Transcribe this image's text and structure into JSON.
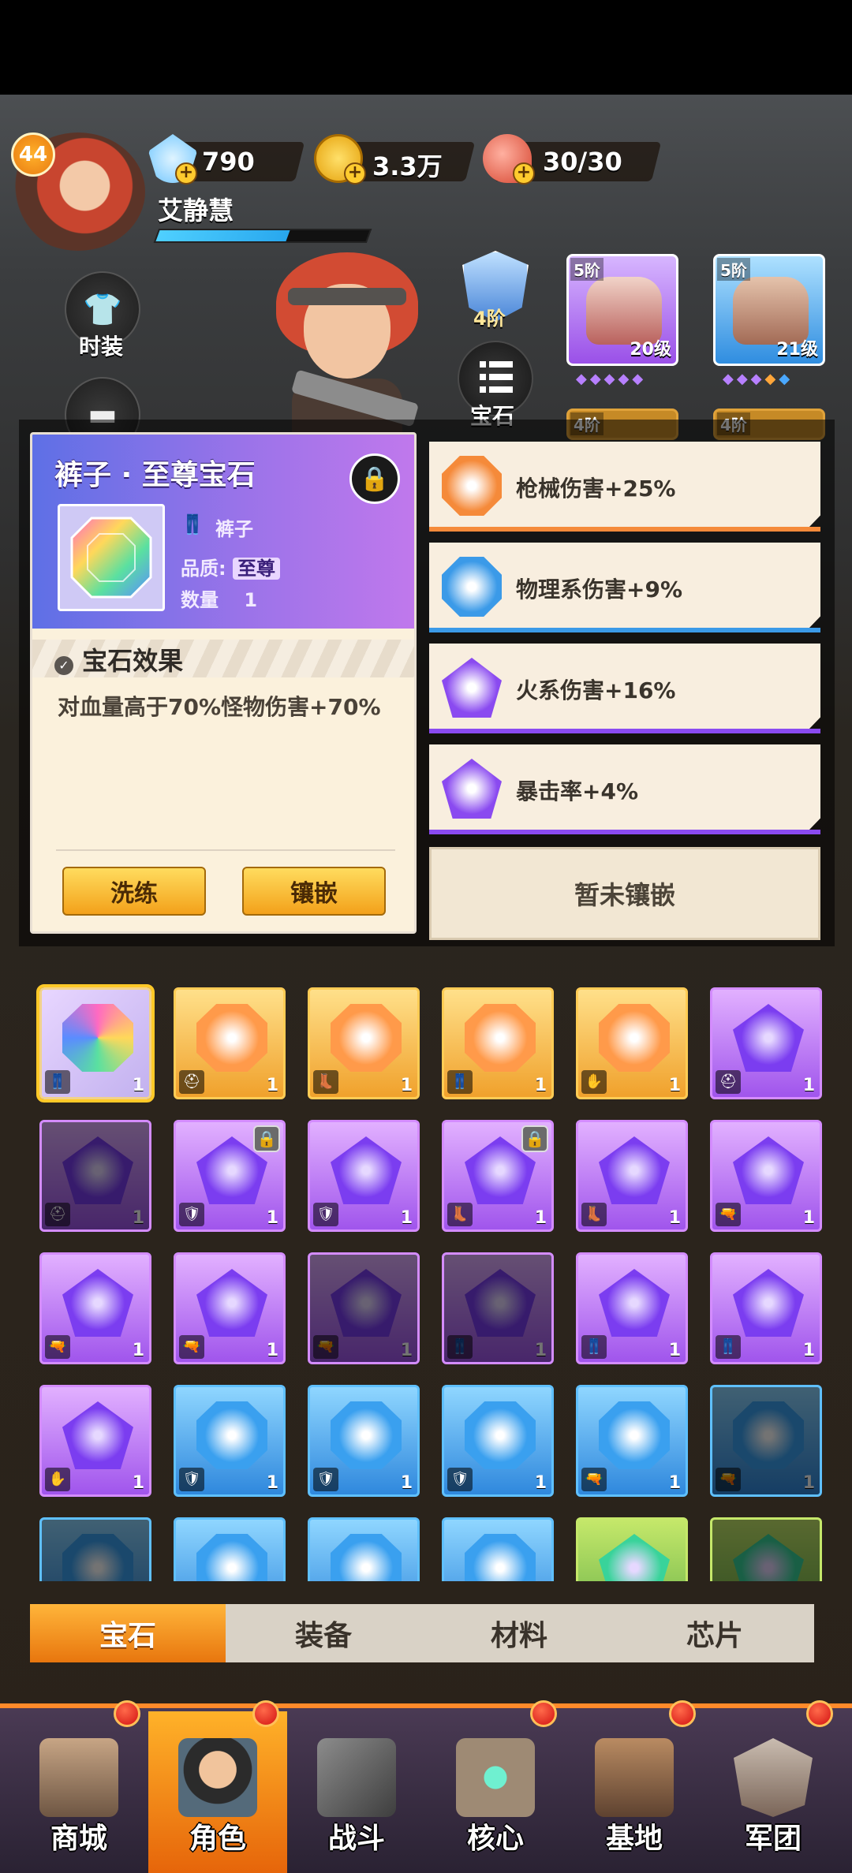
{
  "player": {
    "level": "44",
    "name": "艾静慧",
    "exp_fraction": 0.62
  },
  "resources": {
    "diamonds": "790",
    "coins": "3.3万",
    "stamina": "30/30"
  },
  "side_menu": {
    "fashion_label": "时装"
  },
  "rank": {
    "label": "4阶"
  },
  "gem_menu": {
    "label": "宝石"
  },
  "equipment": [
    {
      "tier": "5阶",
      "level": "20级"
    },
    {
      "tier": "5阶",
      "level": "21级"
    },
    {
      "tier": "4阶"
    },
    {
      "tier": "4阶"
    }
  ],
  "gem_detail": {
    "title": "裤子 · 至尊宝石",
    "slot_name": "裤子",
    "quality_label": "品质:",
    "quality_value": "至尊",
    "count_label": "数量",
    "count_value": "1",
    "effect_title": "宝石效果",
    "effect_text": "对血量高于70%怪物伤害+70%",
    "reroll_label": "洗练",
    "inlay_label": "镶嵌"
  },
  "attributes": [
    {
      "text": "枪械伤害+25%",
      "color": "#f58a3a"
    },
    {
      "text": "物理系伤害+9%",
      "color": "#3b9ae8"
    },
    {
      "text": "火系伤害+16%",
      "color": "#8a4af0"
    },
    {
      "text": "暴击率+4%",
      "color": "#8a4af0"
    }
  ],
  "not_inlaid_label": "暂未镶嵌",
  "inventory": [
    {
      "type": "rainbow",
      "part": "pants",
      "qty": "1",
      "selected": true
    },
    {
      "type": "orange",
      "part": "helmet",
      "qty": "1"
    },
    {
      "type": "orange",
      "part": "boots",
      "qty": "1"
    },
    {
      "type": "orange",
      "part": "pants",
      "qty": "1"
    },
    {
      "type": "orange",
      "part": "glove",
      "qty": "1"
    },
    {
      "type": "purple",
      "part": "helmet",
      "qty": "1"
    },
    {
      "type": "purple",
      "part": "helmet",
      "qty": "1",
      "dim": true
    },
    {
      "type": "purple",
      "part": "armor",
      "qty": "1",
      "locked": true
    },
    {
      "type": "purple",
      "part": "armor",
      "qty": "1"
    },
    {
      "type": "purple",
      "part": "boots",
      "qty": "1",
      "locked": true
    },
    {
      "type": "purple",
      "part": "boots",
      "qty": "1"
    },
    {
      "type": "purple",
      "part": "gun",
      "qty": "1"
    },
    {
      "type": "purple",
      "part": "gun",
      "qty": "1"
    },
    {
      "type": "purple",
      "part": "gun",
      "qty": "1"
    },
    {
      "type": "purple",
      "part": "gun",
      "qty": "1",
      "dim": true
    },
    {
      "type": "purple",
      "part": "pants",
      "qty": "1",
      "dim": true
    },
    {
      "type": "purple",
      "part": "pants",
      "qty": "1"
    },
    {
      "type": "purple",
      "part": "pants",
      "qty": "1"
    },
    {
      "type": "purple",
      "part": "glove",
      "qty": "1"
    },
    {
      "type": "blue",
      "part": "armor",
      "qty": "1"
    },
    {
      "type": "blue",
      "part": "armor",
      "qty": "1"
    },
    {
      "type": "blue",
      "part": "armor",
      "qty": "1"
    },
    {
      "type": "blue",
      "part": "gun",
      "qty": "1"
    },
    {
      "type": "blue",
      "part": "gun",
      "qty": "1",
      "dim": true
    },
    {
      "type": "blue",
      "part": "",
      "qty": "",
      "dim": true
    },
    {
      "type": "blue",
      "part": "",
      "qty": ""
    },
    {
      "type": "blue",
      "part": "",
      "qty": ""
    },
    {
      "type": "blue",
      "part": "",
      "qty": ""
    },
    {
      "type": "green",
      "part": "",
      "qty": ""
    },
    {
      "type": "green",
      "part": "",
      "qty": "",
      "dim": true
    }
  ],
  "tabs": [
    "宝石",
    "装备",
    "材料",
    "芯片"
  ],
  "nav": [
    "商城",
    "角色",
    "战斗",
    "核心",
    "基地",
    "军团"
  ],
  "colors": {
    "accent_orange": "#f39a1e",
    "purple": "#a66bf2",
    "blue": "#3aa2ea",
    "green": "#39c98a"
  }
}
